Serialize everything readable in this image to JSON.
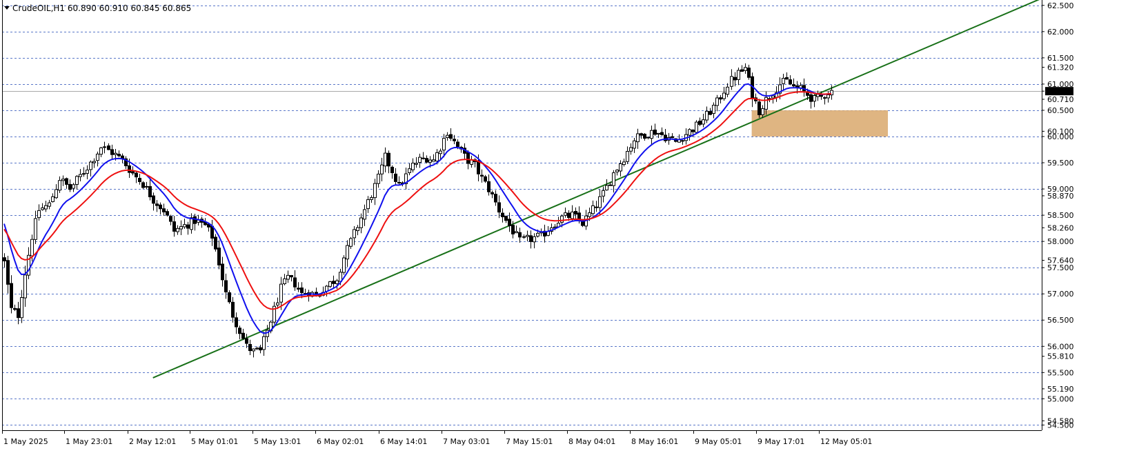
{
  "header": {
    "symbol_info": "CrudeOIL,H1  60.890 60.910 60.845 60.865",
    "menu_icon": "triangle-down-icon"
  },
  "colors": {
    "background": "#ffffff",
    "grid": "#3b5fbf",
    "bull_candle": "#ffffff",
    "bear_candle": "#000000",
    "wick": "#000000",
    "ema_fast": "#1010ee",
    "ema_slow": "#ee1010",
    "trendline": "#187018",
    "zone_fill": "#d9a86c",
    "price_line": "#a8a8a8",
    "current_price_bg": "#000000",
    "current_price_text": "#ffffff"
  },
  "chart_data": {
    "type": "candlestick",
    "symbol": "CrudeOIL",
    "timeframe": "H1",
    "ohlc_header": {
      "open": 60.89,
      "high": 60.91,
      "low": 60.845,
      "close": 60.865
    },
    "current_price": 60.865,
    "ylim": [
      54.4,
      62.55
    ],
    "grid": true,
    "grid_levels": [
      62.5,
      62.0,
      61.5,
      61.0,
      60.5,
      60.0,
      59.5,
      59.0,
      58.5,
      58.0,
      57.5,
      57.0,
      56.5,
      56.0,
      55.5,
      55.0,
      54.5
    ],
    "y_tick_labels": [
      "62.500",
      "62.000",
      "61.500",
      "61.320",
      "61.000",
      "60.865",
      "60.710",
      "60.500",
      "60.100",
      "60.000",
      "59.500",
      "59.000",
      "58.870",
      "58.500",
      "58.260",
      "58.000",
      "57.640",
      "57.500",
      "57.000",
      "56.500",
      "56.000",
      "55.810",
      "55.500",
      "55.190",
      "55.000",
      "54.580",
      "54.500"
    ],
    "x_tick_labels": [
      "1 May 2025",
      "1 May 23:01",
      "2 May 12:01",
      "5 May 01:01",
      "5 May 13:01",
      "6 May 02:01",
      "6 May 14:01",
      "7 May 03:01",
      "7 May 15:01",
      "8 May 04:01",
      "8 May 16:01",
      "9 May 05:01",
      "9 May 17:01",
      "12 May 05:01"
    ],
    "bars_count": 146,
    "close_anchors": [
      [
        0,
        57.6
      ],
      [
        2,
        56.7
      ],
      [
        4,
        56.6
      ],
      [
        6,
        57.4
      ],
      [
        8,
        58.1
      ],
      [
        10,
        58.6
      ],
      [
        13,
        58.7
      ],
      [
        16,
        59.2
      ],
      [
        19,
        59.0
      ],
      [
        22,
        59.25
      ],
      [
        25,
        59.5
      ],
      [
        28,
        59.8
      ],
      [
        31,
        59.7
      ],
      [
        34,
        59.55
      ],
      [
        37,
        59.3
      ],
      [
        40,
        59.1
      ],
      [
        43,
        58.8
      ],
      [
        46,
        58.6
      ],
      [
        49,
        58.2
      ],
      [
        52,
        58.3
      ],
      [
        55,
        58.4
      ],
      [
        58,
        58.3
      ],
      [
        60,
        58.1
      ],
      [
        62,
        57.6
      ],
      [
        64,
        57.0
      ],
      [
        66,
        56.6
      ],
      [
        68,
        56.3
      ],
      [
        70,
        56.0
      ],
      [
        72,
        55.9
      ],
      [
        74,
        55.9
      ],
      [
        76,
        56.3
      ],
      [
        78,
        56.7
      ],
      [
        80,
        57.1
      ],
      [
        82,
        57.3
      ],
      [
        84,
        57.2
      ],
      [
        86,
        57.0
      ],
      [
        88,
        57.05
      ],
      [
        90,
        56.95
      ],
      [
        92,
        57.1
      ],
      [
        94,
        57.2
      ],
      [
        96,
        57.3
      ],
      [
        98,
        57.7
      ],
      [
        100,
        58.0
      ],
      [
        102,
        58.3
      ],
      [
        104,
        58.6
      ],
      [
        106,
        58.9
      ],
      [
        108,
        59.2
      ],
      [
        110,
        59.6
      ],
      [
        112,
        59.35
      ],
      [
        114,
        59.05
      ],
      [
        116,
        59.25
      ],
      [
        118,
        59.45
      ],
      [
        120,
        59.55
      ],
      [
        122,
        59.6
      ],
      [
        124,
        59.55
      ],
      [
        126,
        59.8
      ],
      [
        128,
        60.1
      ],
      [
        130,
        59.9
      ],
      [
        132,
        59.7
      ],
      [
        134,
        59.55
      ],
      [
        136,
        59.45
      ],
      [
        138,
        59.2
      ],
      [
        140,
        59.0
      ],
      [
        143,
        58.6
      ],
      [
        146,
        58.3
      ],
      [
        149,
        58.0
      ],
      [
        152,
        58.05
      ],
      [
        155,
        58.1
      ],
      [
        158,
        58.3
      ],
      [
        161,
        58.45
      ],
      [
        164,
        58.5
      ],
      [
        167,
        58.35
      ],
      [
        170,
        58.6
      ],
      [
        173,
        58.9
      ],
      [
        176,
        59.3
      ],
      [
        179,
        59.6
      ],
      [
        182,
        59.95
      ],
      [
        185,
        60.05
      ],
      [
        188,
        60.1
      ],
      [
        191,
        60.0
      ],
      [
        194,
        59.9
      ],
      [
        197,
        60.05
      ],
      [
        200,
        60.2
      ],
      [
        203,
        60.4
      ],
      [
        206,
        60.65
      ],
      [
        209,
        61.0
      ],
      [
        212,
        61.2
      ],
      [
        214,
        61.3
      ],
      [
        216,
        60.8
      ],
      [
        218,
        60.5
      ],
      [
        220,
        60.7
      ],
      [
        222,
        60.85
      ],
      [
        224,
        61.0
      ],
      [
        226,
        61.05
      ],
      [
        228,
        60.95
      ],
      [
        230,
        60.9
      ],
      [
        232,
        60.8
      ],
      [
        234,
        60.7
      ],
      [
        236,
        60.75
      ],
      [
        238,
        60.85
      ],
      [
        240,
        60.865
      ]
    ],
    "series": [
      {
        "type": "ema",
        "color": "#1010ee",
        "period": 10
      },
      {
        "type": "ema",
        "color": "#ee1010",
        "period": 20
      }
    ],
    "annotations": [
      {
        "type": "trendline",
        "from": {
          "bar": 43,
          "price": 55.4
        },
        "to": {
          "bar": 240,
          "price": 60.95
        },
        "extends_right": true
      },
      {
        "type": "rectangle_zone",
        "bar_from": 216,
        "bar_to": 240,
        "price_low": 60.0,
        "price_high": 60.5
      }
    ]
  }
}
